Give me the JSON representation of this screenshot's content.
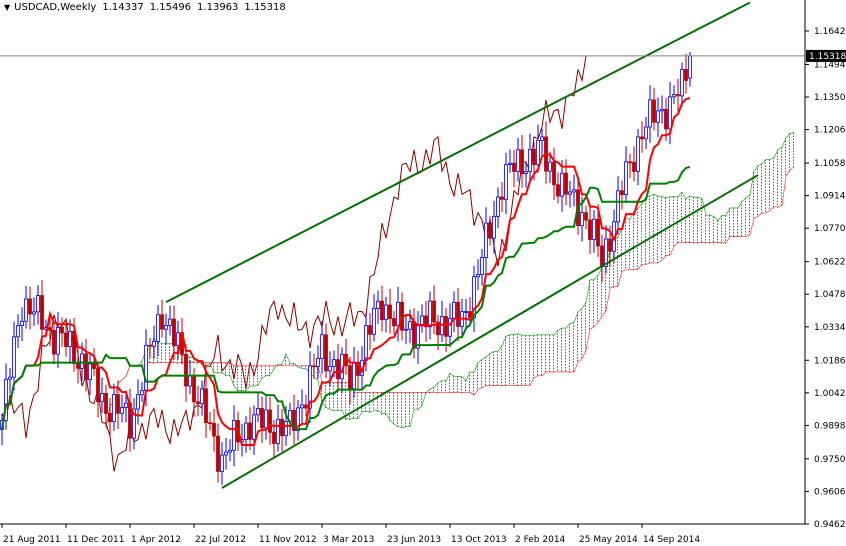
{
  "chart_data": {
    "type": "candlestick",
    "title": {
      "symbol": "USDCAD,Weekly",
      "open": "1.14337",
      "high": "1.15496",
      "low": "1.13963",
      "close": "1.15318"
    },
    "current_price_label": "1.15318",
    "y_ticks": [
      "1.16420",
      "1.14940",
      "1.13500",
      "1.12060",
      "1.10580",
      "1.09140",
      "1.07700",
      "1.06220",
      "1.04780",
      "1.03340",
      "1.01860",
      "1.00420",
      "0.98980",
      "0.97500",
      "0.96060",
      "0.94620"
    ],
    "ylim": [
      0.9462,
      1.1642
    ],
    "x_ticks": [
      {
        "label": "21 Aug 2011",
        "week": 0
      },
      {
        "label": "11 Dec 2011",
        "week": 16
      },
      {
        "label": "1 Apr 2012",
        "week": 32
      },
      {
        "label": "22 Jul 2012",
        "week": 48
      },
      {
        "label": "11 Nov 2012",
        "week": 64
      },
      {
        "label": "3 Mar 2013",
        "week": 80
      },
      {
        "label": "23 Jun 2013",
        "week": 96
      },
      {
        "label": "13 Oct 2013",
        "week": 112
      },
      {
        "label": "2 Feb 2014",
        "week": 128
      },
      {
        "label": "25 May 2014",
        "week": 144
      },
      {
        "label": "14 Sep 2014",
        "week": 160
      }
    ],
    "close_keypoints": [
      [
        0,
        0.992
      ],
      [
        5,
        1.045
      ],
      [
        12,
        1.032
      ],
      [
        20,
        1.019
      ],
      [
        25,
        1.001
      ],
      [
        32,
        0.992
      ],
      [
        40,
        1.041
      ],
      [
        47,
        1.01
      ],
      [
        55,
        0.975
      ],
      [
        62,
        0.992
      ],
      [
        72,
        0.988
      ],
      [
        80,
        1.023
      ],
      [
        87,
        1.01
      ],
      [
        95,
        1.045
      ],
      [
        100,
        1.032
      ],
      [
        107,
        1.036
      ],
      [
        115,
        1.036
      ],
      [
        120,
        1.063
      ],
      [
        125,
        1.098
      ],
      [
        130,
        1.107
      ],
      [
        135,
        1.111
      ],
      [
        140,
        1.094
      ],
      [
        145,
        1.085
      ],
      [
        150,
        1.063
      ],
      [
        155,
        1.094
      ],
      [
        160,
        1.121
      ],
      [
        165,
        1.129
      ],
      [
        170,
        1.138
      ],
      [
        172,
        1.15318
      ]
    ],
    "indicators": [
      "Ichimoku Tenkan-sen (red)",
      "Kijun-sen (green)",
      "Chikou span (dark red)",
      "Senkou cloud"
    ],
    "trendlines": [
      {
        "name": "upper-channel",
        "from": [
          41,
          1.0443
        ],
        "to": [
          187,
          1.1768
        ]
      },
      {
        "name": "lower-channel",
        "from": [
          55,
          0.9621
        ],
        "to": [
          189,
          1.1005
        ]
      }
    ],
    "horizontal_line": 1.15318,
    "colors": {
      "bull": "#0000ff",
      "bear": "#c00000",
      "tenkan": "#ff0000",
      "kijun": "#008000",
      "chikou": "#8b0000",
      "trend": "#007000",
      "cloud_up": "#00a000",
      "cloud_down": "#ff2020"
    }
  }
}
